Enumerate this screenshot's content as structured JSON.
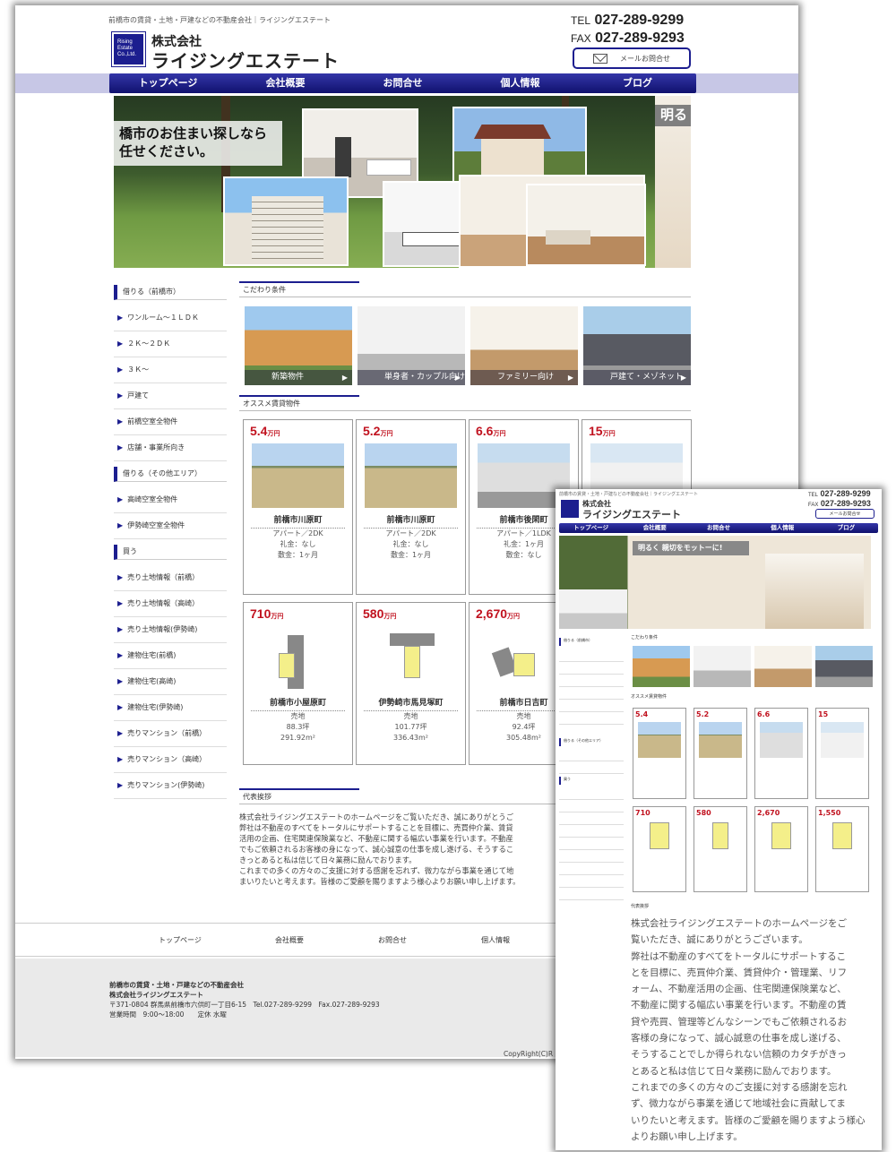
{
  "header": {
    "tagline": "前橋市の賃貸・土地・戸建などの不動産会社｜ライジングエステート",
    "logo_mark": "Rising Estate Co.,Ltd.",
    "company_prefix": "株式会社",
    "company_name": "ライジングエステート",
    "tel_label": "TEL",
    "tel": "027-289-9299",
    "fax_label": "FAX",
    "fax": "027-289-9293",
    "mail_button": "メールお問合せ"
  },
  "nav": [
    "トップページ",
    "会社概要",
    "お問合せ",
    "個人情報",
    "ブログ"
  ],
  "hero": {
    "banner_line1": "橋市のお住まい探しなら",
    "banner_line2": "任せください。",
    "side_text": "明る",
    "mobile_banner": "明るく 親切をモットーに!"
  },
  "sidebar": {
    "sections": [
      {
        "heading": "借りる（前橋市）",
        "items": [
          "ワンルーム～１ＬＤＫ",
          "２Ｋ～２ＤＫ",
          "３Ｋ～",
          "戸建て",
          "前橋空室全物件",
          "店舗・事業所向き"
        ]
      },
      {
        "heading": "借りる（その他エリア）",
        "items": [
          "高崎空室全物件",
          "伊勢崎空室全物件"
        ]
      },
      {
        "heading": "買う",
        "items": [
          "売り土地情報（前橋）",
          "売り土地情報（高崎）",
          "売り土地情報(伊勢崎)",
          "建物住宅(前橋)",
          "建物住宅(高崎)",
          "建物住宅(伊勢崎)",
          "売りマンション（前橋）",
          "売りマンション（高崎）",
          "売りマンション(伊勢崎)"
        ]
      }
    ]
  },
  "kodawari": {
    "title": "こだわり条件",
    "items": [
      "新築物件",
      "単身者・カップル向け",
      "ファミリー向け",
      "戸建て・メゾネット"
    ]
  },
  "recommend": {
    "title": "オススメ賃貸物件",
    "price_unit": "万円",
    "rentals": [
      {
        "price": "5.4",
        "location": "前橋市川原町",
        "type": "アパート／2DK",
        "key_money": "礼金：なし",
        "deposit": "敷金：1ヶ月"
      },
      {
        "price": "5.2",
        "location": "前橋市川原町",
        "type": "アパート／2DK",
        "key_money": "礼金：なし",
        "deposit": "敷金：1ヶ月"
      },
      {
        "price": "6.6",
        "location": "前橋市後閑町",
        "type": "アパート／1LDK",
        "key_money": "礼金：1ヶ月",
        "deposit": "敷金：なし"
      },
      {
        "price": "15",
        "location": "",
        "type": "",
        "key_money": "",
        "deposit": ""
      }
    ],
    "land": [
      {
        "price": "710",
        "location": "前橋市小屋原町",
        "type": "売地",
        "tsubo": "88.3坪",
        "area": "291.92m²"
      },
      {
        "price": "580",
        "location": "伊勢崎市馬見塚町",
        "type": "売地",
        "tsubo": "101.77坪",
        "area": "336.43m²"
      },
      {
        "price": "2,670",
        "location": "前橋市日吉町",
        "type": "売地",
        "tsubo": "92.4坪",
        "area": "305.48m²"
      }
    ],
    "mobile_land_extra_price": "1,550"
  },
  "greeting": {
    "title": "代表挨拶",
    "lines": [
      "株式会社ライジングエステートのホームページをご覧いただき、誠にありがとうご",
      "弊社は不動産のすべてをトータルにサポートすることを目標に、売買仲介業、賃貸",
      "活用の企画、住宅関連保険業など、不動産に関する幅広い事業を行います。不動産",
      "でもご依頼されるお客様の身になって、誠心誠意の仕事を成し遂げる、そうするこ",
      "きっとあると私は信じて日々業務に励んでおります。",
      "これまでの多くの方々のご支援に対する感謝を忘れず、微力ながら事業を通じて地",
      "まいりたいと考えます。皆様のご愛顧を賜りますよう様心よりお願い申し上げます。"
    ],
    "mobile_text": [
      "株式会社ライジングエステートのホームページをご",
      "覧いただき、誠にありがとうございます。",
      "弊社は不動産のすべてをトータルにサポートするこ",
      "とを目標に、売買仲介業、賃貸仲介・管理業、リフ",
      "ォーム、不動産活用の企画、住宅関連保険業など、",
      "不動産に関する幅広い事業を行います。不動産の賃",
      "貸や売買、管理等どんなシーンでもご依頼されるお",
      "客様の身になって、誠心誠意の仕事を成し遂げる、",
      "そうすることでしか得られない信頼のカタチがきっ",
      "とあると私は信じて日々業務に励んでおります。",
      "これまでの多くの方々のご支援に対する感謝を忘れ",
      "ず、微力ながら事業を通じて地域社会に貢献してま",
      "いりたいと考えます。皆様のご愛顧を賜りますよう様心",
      "よりお願い申し上げます。"
    ]
  },
  "footer": {
    "nav": [
      "トップページ",
      "会社概要",
      "お問合せ",
      "個人情報"
    ],
    "line1": "前橋市の賃貸・土地・戸建などの不動産会社",
    "line2": "株式会社ライジングエステート",
    "address": "〒371-0804 群馬県前橋市六供町一丁目6-15　Tel.027-289-9299　Fax.027-289-9293",
    "hours": "営業時間　9:00～18:00　　定休 水曜",
    "copyright": "CopyRight(C)R"
  },
  "colors": {
    "brand": "#1c1e8f",
    "price": "#c1121f",
    "nav_band": "#c7c7e6"
  }
}
